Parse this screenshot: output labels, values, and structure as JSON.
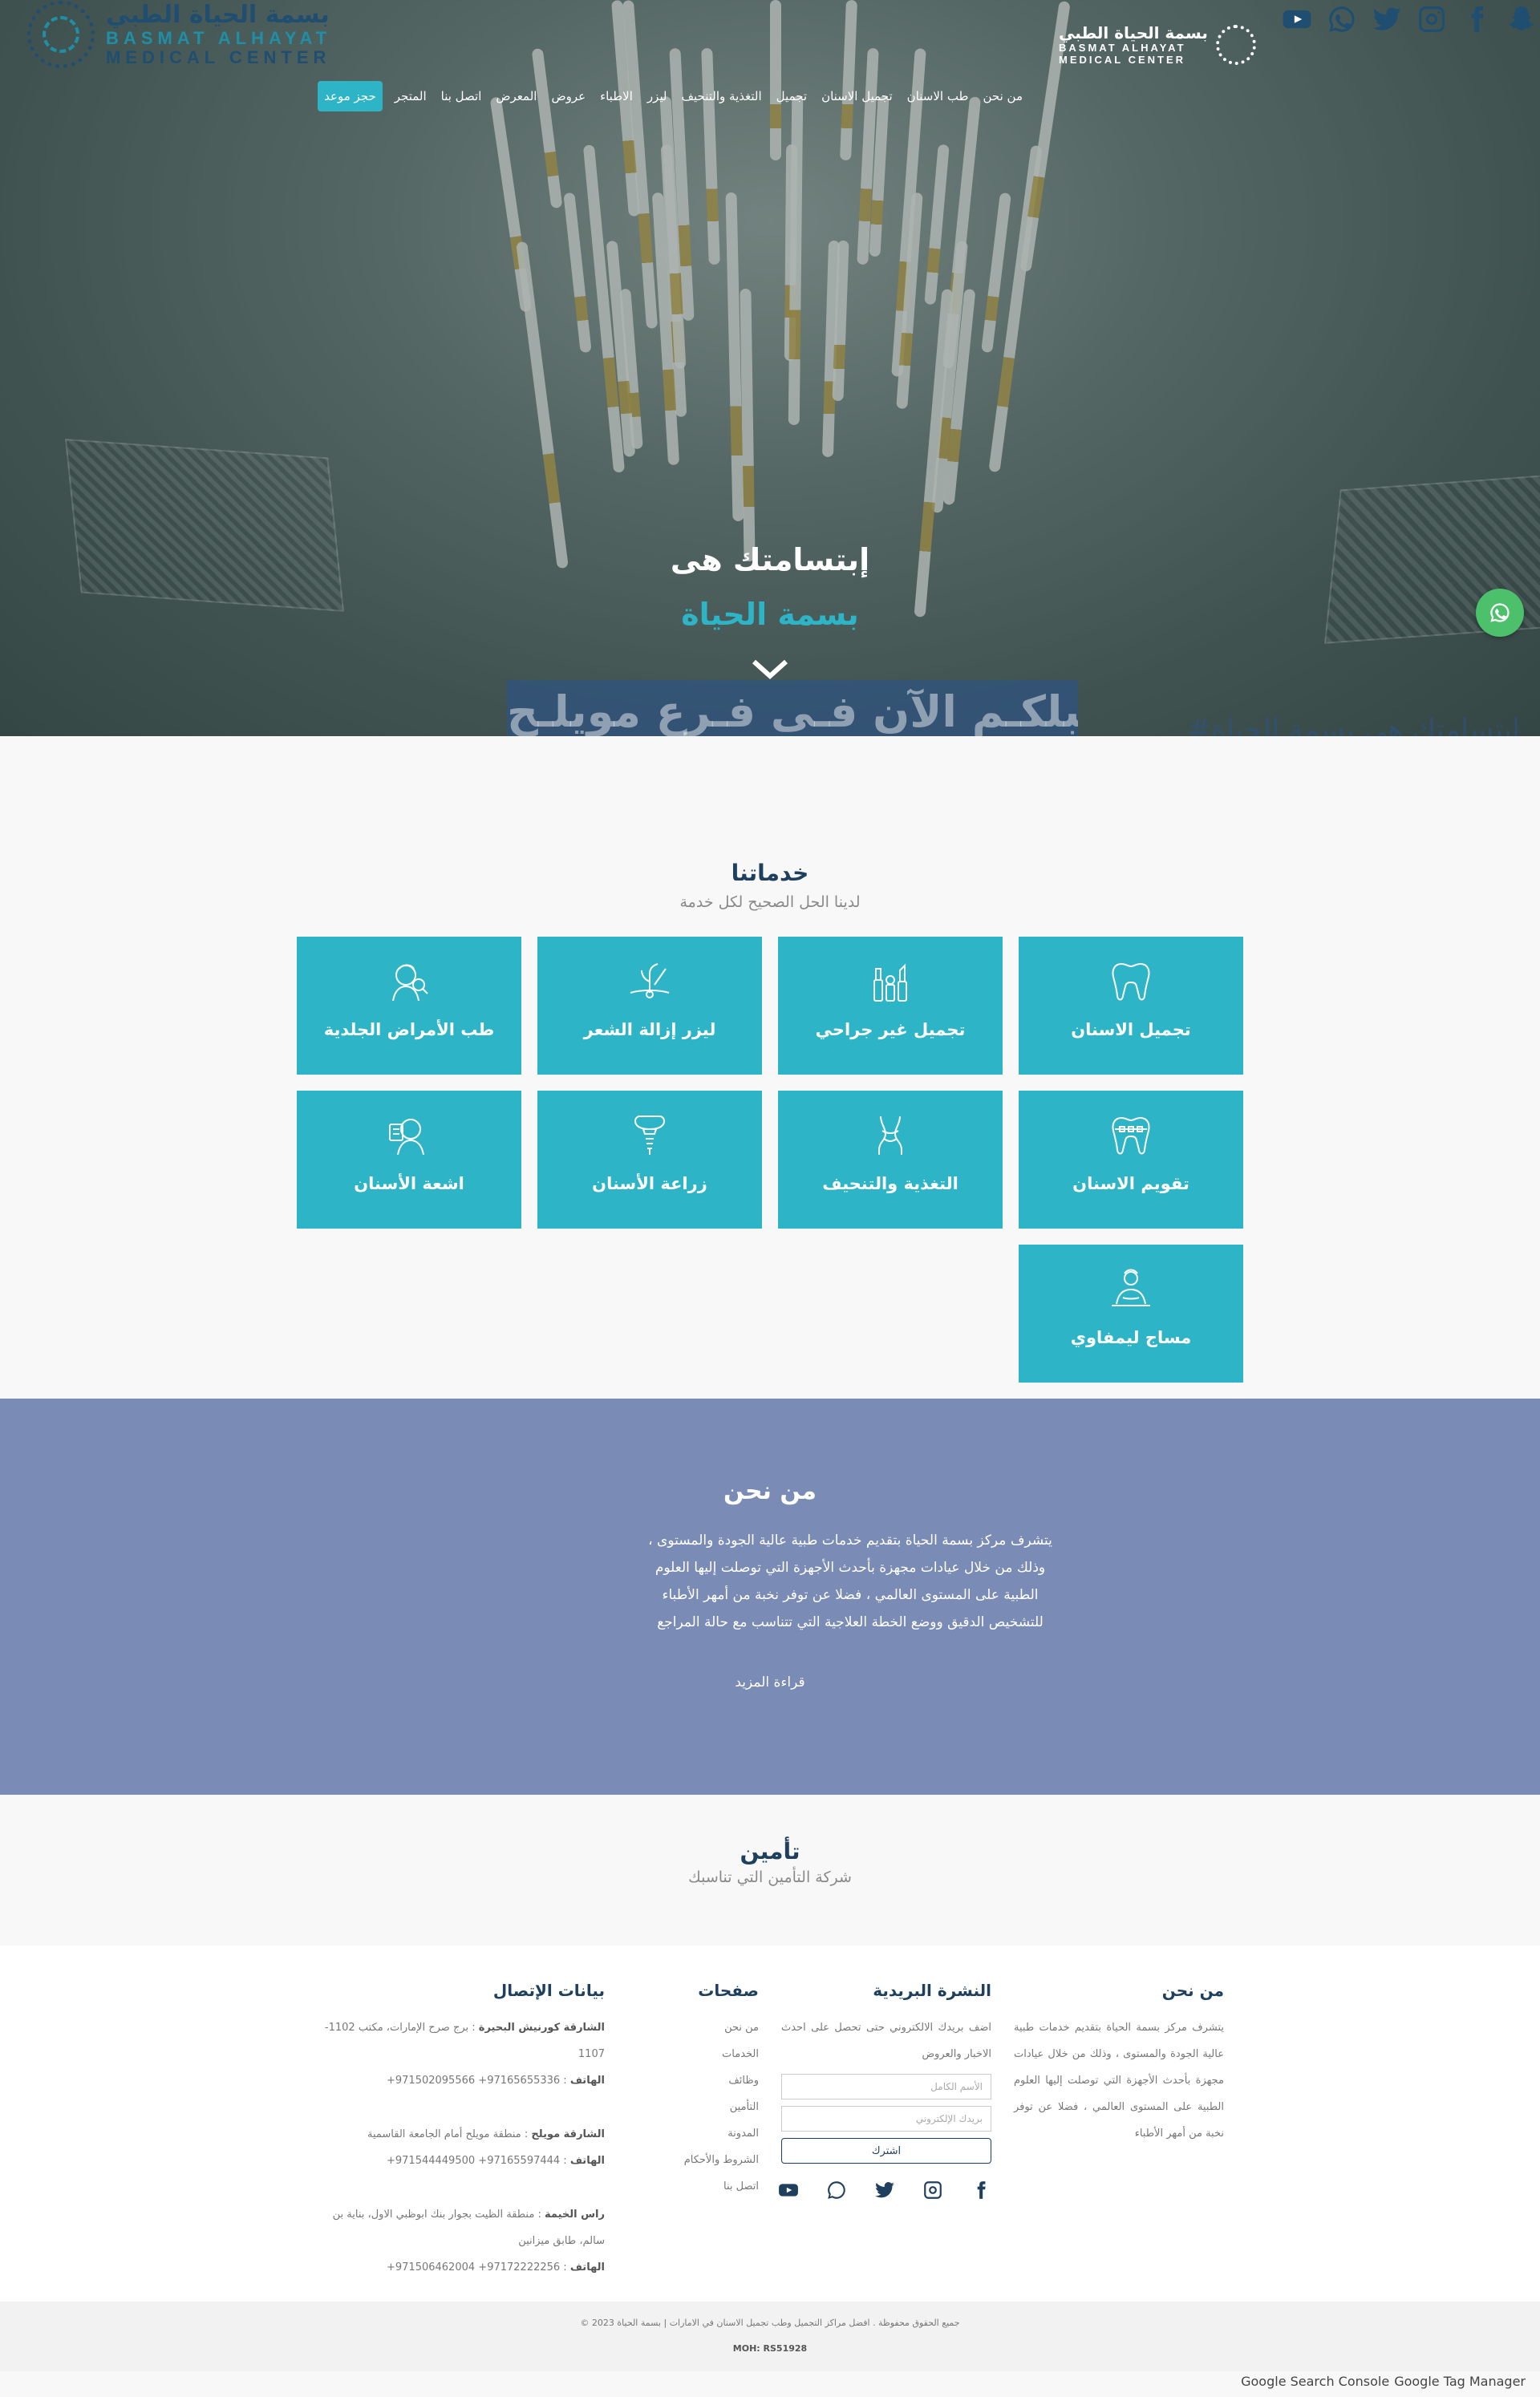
{
  "header": {
    "logo_left": {
      "ar": "بسمة الحياة الطبي",
      "en1": "BASMAT ALHAYAT",
      "en2": "MEDICAL CENTER"
    },
    "logo_center": {
      "ar": "بسمة الحياة الطبي",
      "en1": "BASMAT ALHAYAT",
      "en2": "MEDICAL CENTER"
    },
    "social_icons": [
      "youtube-icon",
      "whatsapp-icon",
      "twitter-icon",
      "instagram-icon",
      "facebook-icon",
      "snapchat-icon"
    ],
    "nav": [
      "من نحن",
      "طب الاسنان",
      "تجميل الاسنان",
      "تجميل",
      "التغذية والتنحيف",
      "ليزر",
      "الاطباء",
      "عروض",
      "المعرض",
      "اتصل بنا",
      "المتجر"
    ],
    "book_label": "حجز موعد"
  },
  "hero": {
    "title": "إبتسامتك هى",
    "subtitle": "بسمة الحياة",
    "banner": "نستقبلكـم الآن فـى فـرع مويلـح",
    "hashtag": "#إبتسامتك هي بسمة الحياة"
  },
  "services": {
    "title": "خدماتنا",
    "subtitle": "لدينا الحل الصحيح لكل خدمة",
    "items": [
      {
        "label": "تجميل الاسنان",
        "icon": "tooth-icon"
      },
      {
        "label": "تجميل غير جراحي",
        "icon": "cosmetics-icon"
      },
      {
        "label": "ليزر إزالة الشعر",
        "icon": "hair-laser-icon"
      },
      {
        "label": "طب الأمراض الجلدية",
        "icon": "dermatology-icon"
      },
      {
        "label": "تقويم الاسنان",
        "icon": "braces-icon"
      },
      {
        "label": "التغذية والتنحيف",
        "icon": "body-slim-icon"
      },
      {
        "label": "زراعة الأسنان",
        "icon": "implant-icon"
      },
      {
        "label": "اشعة الأسنان",
        "icon": "xray-icon"
      },
      {
        "label": "مساج ليمفاوي",
        "icon": "massage-icon"
      }
    ],
    "accent": "#2db4c7"
  },
  "about": {
    "title": "من نحن",
    "text": "يتشرف مركز بسمة الحياة بتقديم خدمات طبية عالية الجودة والمستوى ، وذلك من خلال عيادات مجهزة بأحدث الأجهزة التي توصلت إليها العلوم الطبية على المستوى العالمي ، فضلا عن توفر نخبة من أمهر الأطباء للتشخيص الدقيق ووضع الخطة العلاجية التي تتناسب مع حالة المراجع",
    "more": "قراءة المزيد",
    "bg": "#7a8bb5"
  },
  "insurance": {
    "title": "تأمين",
    "subtitle": "شركة التأمين التي تناسبك"
  },
  "footer": {
    "about": {
      "title": "من نحن",
      "text": "يتشرف مركز بسمة الحياة بتقديم خدمات طبية عالية الجودة والمستوى ، وذلك من خلال عيادات مجهزة بأحدث الأجهزة التي توصلت إليها العلوم الطبية على المستوى العالمي ، فضلا عن توفر نخبة من أمهر الأطباء"
    },
    "newsletter": {
      "title": "النشرة البريدية",
      "text": "اضف بريدك الالكتروني حتى تحصل على احدث الاخبار والعروض",
      "name_placeholder": "الأسم الكامل",
      "email_placeholder": "بريدك الإلكتروني",
      "subscribe": "اشترك"
    },
    "pages": {
      "title": "صفحات",
      "links": [
        "من نحن",
        "الخدمات",
        "وظائف",
        "التأمين",
        "المدونة",
        "الشروط والأحكام",
        "اتصل بنا"
      ]
    },
    "contact": {
      "title": "بيانات الإتصال",
      "branches": [
        {
          "name": "الشارقة كورنيش البحيرة",
          "address": " : برج صرح الإمارات، مكتب 1102-1107",
          "phone_label": "الهاتف",
          "phones": " : 97165655336+   971502095566+"
        },
        {
          "name": "الشارقة مويلح",
          "address": " : منطقة مويلح أمام الجامعة القاسمية",
          "phone_label": "الهاتف",
          "phones": " : 97165597444+   971544449500+"
        },
        {
          "name": "راس الخيمة",
          "address": " : منطقة الظيت بجوار بنك ابوظبي الاول، بناية بن سالم، طابق ميزانين",
          "phone_label": "الهاتف",
          "phones": " : 97172222256+   971506462004+"
        }
      ]
    }
  },
  "bottom": {
    "copyright": "© 2023 جميع الحقوق محفوظة .   افضل مراكز التجميل وطب تجميل الاسنان في الامارات | بسمة الحياة",
    "moh": "MOH: RS51928"
  },
  "gtm": [
    "Google Search Console",
    "Google Tag Manager"
  ]
}
